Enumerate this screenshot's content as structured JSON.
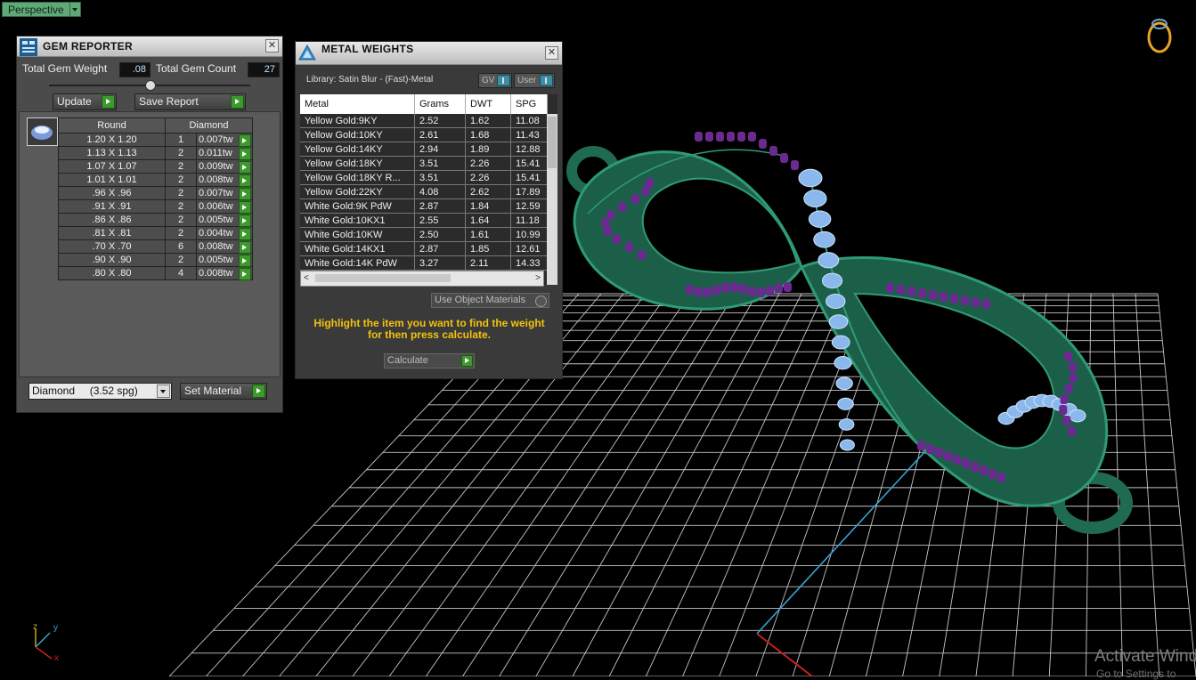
{
  "viewport": {
    "view_mode": "Perspective",
    "axis_labels": {
      "z": "z",
      "y": "y",
      "x": "x"
    },
    "watermark_line1": "Activate Wind",
    "watermark_line2": "Go to Settings to"
  },
  "gem_reporter": {
    "title": "GEM REPORTER",
    "total_weight_label": "Total Gem Weight",
    "total_weight_value": ".08",
    "total_count_label": "Total Gem Count",
    "total_count_value": "27",
    "update_label": "Update",
    "save_report_label": "Save Report",
    "col_shape": "Round",
    "col_material": "Diamond",
    "rows": [
      {
        "size": "1.20 X 1.20",
        "count": "1",
        "weight": "0.007tw"
      },
      {
        "size": "1.13 X 1.13",
        "count": "2",
        "weight": "0.011tw"
      },
      {
        "size": "1.07 X 1.07",
        "count": "2",
        "weight": "0.009tw"
      },
      {
        "size": "1.01 X 1.01",
        "count": "2",
        "weight": "0.008tw"
      },
      {
        "size": ".96 X .96",
        "count": "2",
        "weight": "0.007tw"
      },
      {
        "size": ".91 X .91",
        "count": "2",
        "weight": "0.006tw"
      },
      {
        "size": ".86 X .86",
        "count": "2",
        "weight": "0.005tw"
      },
      {
        "size": ".81 X .81",
        "count": "2",
        "weight": "0.004tw"
      },
      {
        "size": ".70 X .70",
        "count": "6",
        "weight": "0.008tw"
      },
      {
        "size": ".90 X .90",
        "count": "2",
        "weight": "0.005tw"
      },
      {
        "size": ".80 X .80",
        "count": "4",
        "weight": "0.008tw"
      }
    ],
    "material_select": "Diamond     (3.52 spg)",
    "set_material_label": "Set Material"
  },
  "metal_weights": {
    "title": "METAL WEIGHTS",
    "library": "Library: Satin Blur - (Fast)-Metal",
    "toggle_gv": "GV",
    "toggle_user": "User",
    "headers": [
      "Metal",
      "Grams",
      "DWT",
      "SPG"
    ],
    "rows": [
      [
        "Yellow Gold:9KY",
        "2.52",
        "1.62",
        "11.08"
      ],
      [
        "Yellow Gold:10KY",
        "2.61",
        "1.68",
        "11.43"
      ],
      [
        "Yellow Gold:14KY",
        "2.94",
        "1.89",
        "12.88"
      ],
      [
        "Yellow Gold:18KY",
        "3.51",
        "2.26",
        "15.41"
      ],
      [
        "Yellow Gold:18KY R...",
        "3.51",
        "2.26",
        "15.41"
      ],
      [
        "Yellow Gold:22KY",
        "4.08",
        "2.62",
        "17.89"
      ],
      [
        "White Gold:9K PdW",
        "2.87",
        "1.84",
        "12.59"
      ],
      [
        "White Gold:10KX1",
        "2.55",
        "1.64",
        "11.18"
      ],
      [
        "White Gold:10KW",
        "2.50",
        "1.61",
        "10.99"
      ],
      [
        "White Gold:14KX1",
        "2.87",
        "1.85",
        "12.61"
      ],
      [
        "White Gold:14K PdW",
        "3.27",
        "2.11",
        "14.33"
      ]
    ],
    "use_object_materials": "Use Object Materials",
    "hint": "Highlight the item you want to find the weight for then press calculate.",
    "calculate_label": "Calculate"
  },
  "colors": {
    "pendant_green": "#1f6b52",
    "gem_blue": "#8ab8ec",
    "prong_purple": "#6a2a8f",
    "hint_yellow": "#f4c20d",
    "go_green": "#3c9a2c"
  }
}
